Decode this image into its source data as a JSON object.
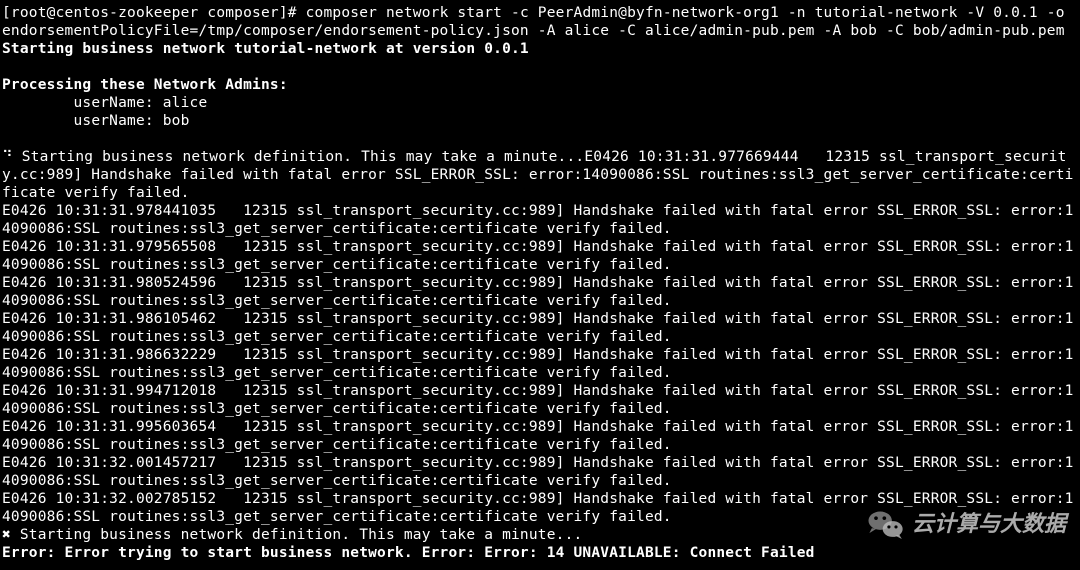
{
  "prompt": {
    "user_host": "[root@centos-zookeeper composer]#",
    "command": "composer network start -c PeerAdmin@byfn-network-org1 -n tutorial-network -V 0.0.1 -o endorsementPolicyFile=/tmp/composer/endorsement-policy.json -A alice -C alice/admin-pub.pem -A bob -C bob/admin-pub.pem"
  },
  "start_line": "Starting business network tutorial-network at version 0.0.1",
  "admins_header": "Processing these Network Admins:",
  "admins": [
    "        userName: alice",
    "        userName: bob"
  ],
  "starting_prefix": "⠙ Starting business network definition. This may take a minute...",
  "first_error": "E0426 10:31:31.977669444   12315 ssl_transport_security.cc:989] Handshake failed with fatal error SSL_ERROR_SSL: error:14090086:SSL routines:ssl3_get_server_certificate:certificate verify failed.",
  "errors": [
    "E0426 10:31:31.978441035   12315 ssl_transport_security.cc:989] Handshake failed with fatal error SSL_ERROR_SSL: error:14090086:SSL routines:ssl3_get_server_certificate:certificate verify failed.",
    "E0426 10:31:31.979565508   12315 ssl_transport_security.cc:989] Handshake failed with fatal error SSL_ERROR_SSL: error:14090086:SSL routines:ssl3_get_server_certificate:certificate verify failed.",
    "E0426 10:31:31.980524596   12315 ssl_transport_security.cc:989] Handshake failed with fatal error SSL_ERROR_SSL: error:14090086:SSL routines:ssl3_get_server_certificate:certificate verify failed.",
    "E0426 10:31:31.986105462   12315 ssl_transport_security.cc:989] Handshake failed with fatal error SSL_ERROR_SSL: error:14090086:SSL routines:ssl3_get_server_certificate:certificate verify failed.",
    "E0426 10:31:31.986632229   12315 ssl_transport_security.cc:989] Handshake failed with fatal error SSL_ERROR_SSL: error:14090086:SSL routines:ssl3_get_server_certificate:certificate verify failed.",
    "E0426 10:31:31.994712018   12315 ssl_transport_security.cc:989] Handshake failed with fatal error SSL_ERROR_SSL: error:14090086:SSL routines:ssl3_get_server_certificate:certificate verify failed.",
    "E0426 10:31:31.995603654   12315 ssl_transport_security.cc:989] Handshake failed with fatal error SSL_ERROR_SSL: error:14090086:SSL routines:ssl3_get_server_certificate:certificate verify failed.",
    "E0426 10:31:32.001457217   12315 ssl_transport_security.cc:989] Handshake failed with fatal error SSL_ERROR_SSL: error:14090086:SSL routines:ssl3_get_server_certificate:certificate verify failed.",
    "E0426 10:31:32.002785152   12315 ssl_transport_security.cc:989] Handshake failed with fatal error SSL_ERROR_SSL: error:14090086:SSL routines:ssl3_get_server_certificate:certificate verify failed."
  ],
  "fail_spinner": "✖ Starting business network definition. This may take a minute...",
  "final_error": "Error: Error trying to start business network. Error: Error: 14 UNAVAILABLE: Connect Failed",
  "watermark_text": "云计算与大数据"
}
